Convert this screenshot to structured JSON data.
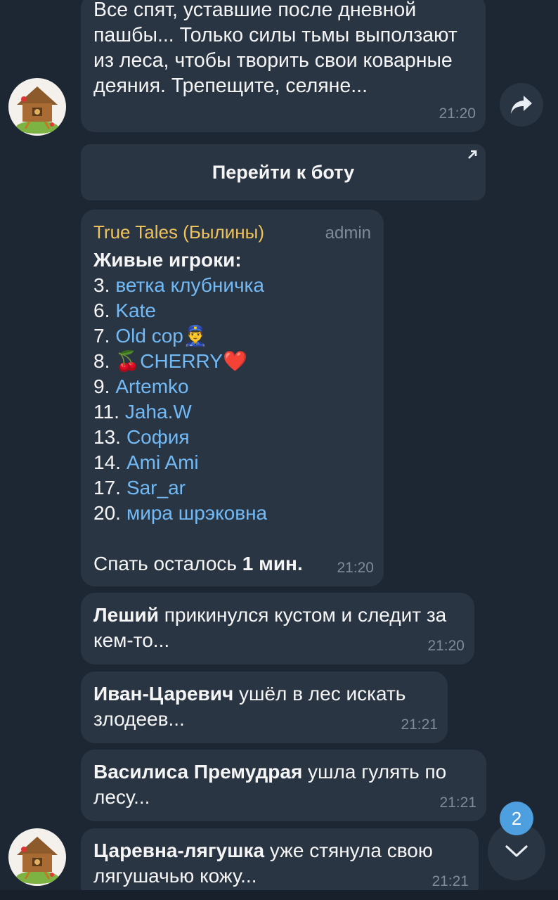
{
  "messages": {
    "m1": {
      "text": "Все спят, уставшие после дневной пашбы... Только силы тьмы выползают из леса, чтобы творить свои коварные деяния. Трепещите, селяне...",
      "time": "21:20"
    },
    "bot_button": {
      "label": "Перейти к боту"
    },
    "m2": {
      "sender": "True Tales (Былины)",
      "badge": "admin",
      "heading": "Живые игроки:",
      "players": [
        {
          "num": "3.",
          "name": "ветка клубничка",
          "emoji": ""
        },
        {
          "num": "6.",
          "name": "Kate",
          "emoji": ""
        },
        {
          "num": "7.",
          "name": "Old cop",
          "emoji": "👮‍♂️"
        },
        {
          "num": "8.",
          "name": "🍒CHERRY",
          "emoji": "❤️"
        },
        {
          "num": "9.",
          "name": "Artemko",
          "emoji": ""
        },
        {
          "num": "11.",
          "name": "Jaha.W",
          "emoji": ""
        },
        {
          "num": "13.",
          "name": "София",
          "emoji": ""
        },
        {
          "num": "14.",
          "name": "Ami Ami",
          "emoji": ""
        },
        {
          "num": "17.",
          "name": "Sar_ar",
          "emoji": ""
        },
        {
          "num": "20.",
          "name": "мира шрэковна",
          "emoji": ""
        }
      ],
      "footer_prefix": "Спать осталось ",
      "footer_bold": "1 мин.",
      "time": "21:20"
    },
    "m3": {
      "bold": "Леший",
      "text": " прикинулся кустом и следит за кем-то...",
      "time": "21:20"
    },
    "m4": {
      "bold": "Иван-Царевич",
      "text": " ушёл в лес искать злодеев...",
      "time": "21:21"
    },
    "m5": {
      "bold": "Василиса Премудрая",
      "text": " ушла гулять по лесу...",
      "time": "21:21"
    },
    "m6": {
      "bold": "Царевна-лягушка",
      "text": " уже стянула свою лягушачью кожу...",
      "time": "21:21"
    }
  },
  "scroll": {
    "unread_count": "2"
  },
  "icons": {
    "forward": "share-arrow-icon",
    "bot_link": "open-external-icon",
    "scroll_down": "chevron-down-icon",
    "avatar": "hut-on-chicken-legs"
  },
  "colors": {
    "background": "#1d2733",
    "bubble": "#2a3543",
    "link": "#71baf6",
    "sender": "#f0c35a",
    "time": "#7f8b99",
    "badge": "#4e9fe0"
  }
}
